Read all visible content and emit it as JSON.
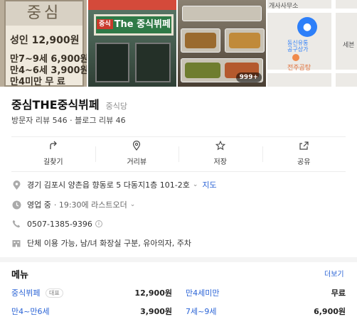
{
  "photos": {
    "board": {
      "head": "중심",
      "adult": "성인 12,900원",
      "kid7": "만7~9세 6,900원",
      "kid4": "만4~6세 3,900원",
      "under4": "만4미만  무 료"
    },
    "storefront_sign": "The 중식뷔페",
    "sign_badge": "중식",
    "photo_count": "999+",
    "map_labels": {
      "top": "개사사무소",
      "place": "동신유통\n공구상가",
      "poi": "전주곰탕",
      "right": "세븐"
    }
  },
  "place": {
    "name": "중심THE중식뷔페",
    "category": "중식당",
    "visitor_reviews": "방문자 리뷰 546",
    "blog_reviews": "블로그 리뷰 46",
    "review_sep": "·"
  },
  "actions": [
    {
      "icon": "directions-icon",
      "label": "길찾기"
    },
    {
      "icon": "street-view-icon",
      "label": "거리뷰"
    },
    {
      "icon": "star-icon",
      "label": "저장"
    },
    {
      "icon": "share-icon",
      "label": "공유"
    }
  ],
  "info": {
    "address": "경기 김포시 양촌읍 향동로 5 다동지1층 101-2호",
    "map_link": "지도",
    "hours_status": "영업 중",
    "hours_detail": "· 19:30에 라스트오더",
    "phone": "0507-1385-9396",
    "amenities": "단체 이용 가능, 남/녀 화장실 구분, 유아의자, 주차"
  },
  "menu": {
    "title": "메뉴",
    "more": "더보기",
    "items": [
      {
        "name": "중식뷔페",
        "badge": "대표",
        "price": "12,900원"
      },
      {
        "name": "만4세미만",
        "price": "무료"
      },
      {
        "name": "만4~만6세",
        "price": "3,900원"
      },
      {
        "name": "7세~9세",
        "price": "6,900원"
      }
    ]
  },
  "colors": {
    "link": "#2b64d6",
    "pin": "#2d7ff9",
    "sign_green": "#2f7a47"
  }
}
